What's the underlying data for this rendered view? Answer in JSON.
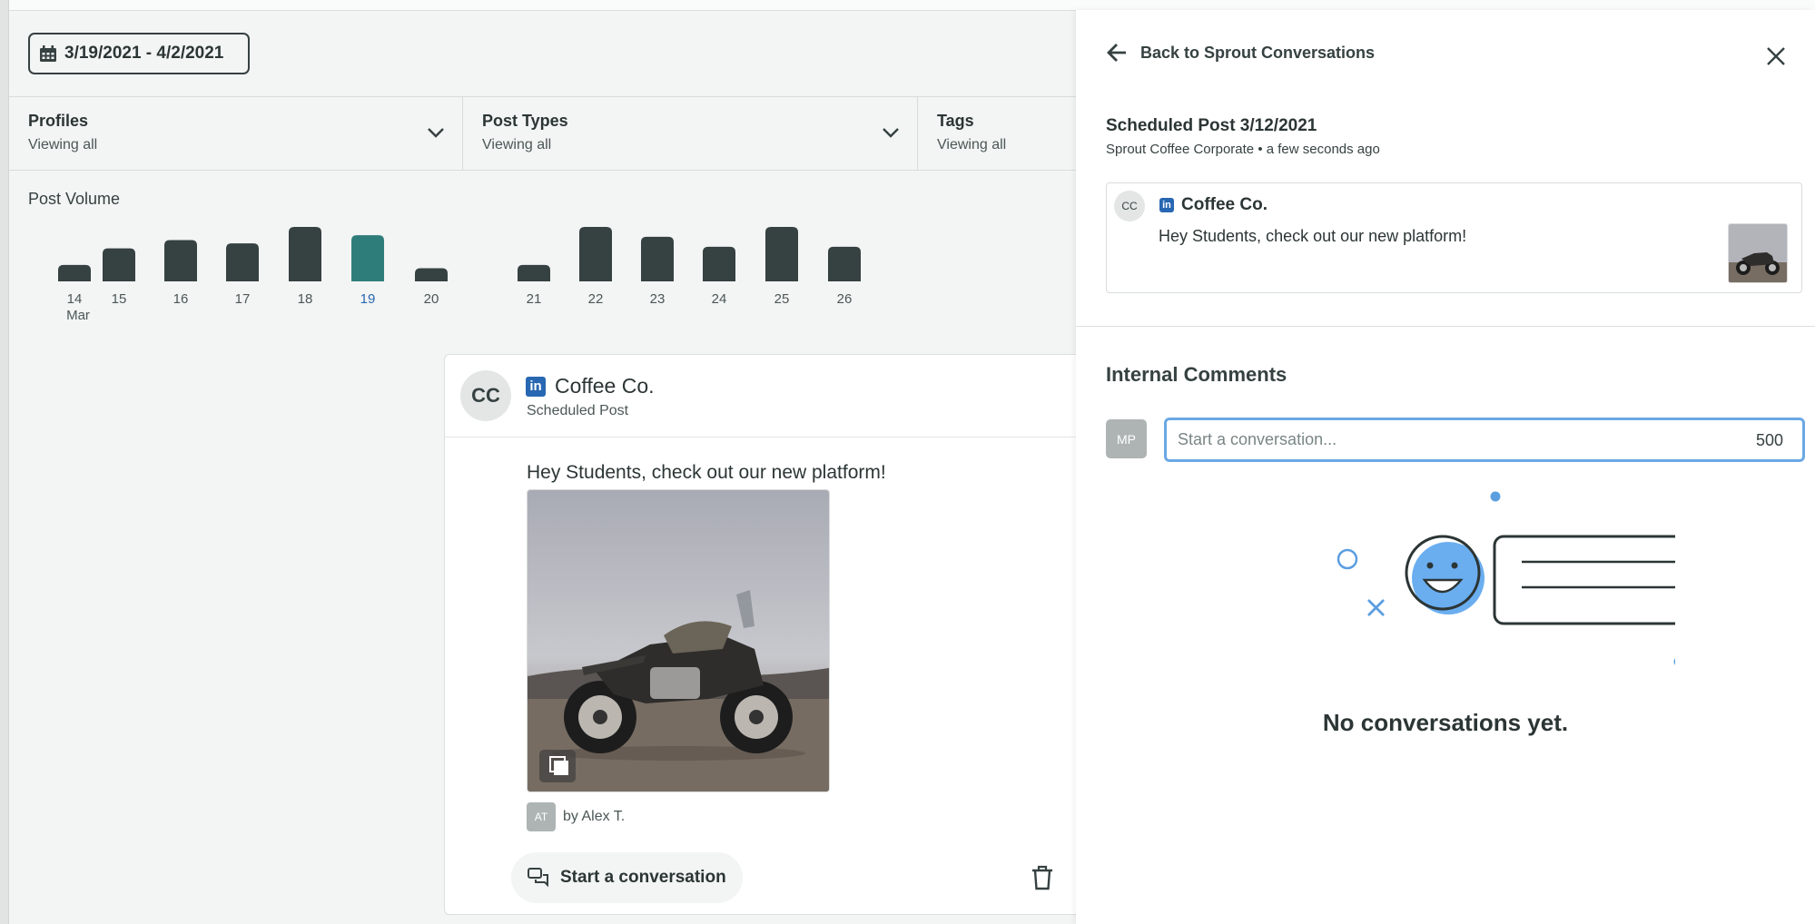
{
  "date_range": {
    "label": "3/19/2021 - 4/2/2021"
  },
  "filters": [
    {
      "title": "Profiles",
      "sub": "Viewing all"
    },
    {
      "title": "Post Types",
      "sub": "Viewing all"
    },
    {
      "title": "Tags",
      "sub": "Viewing all"
    }
  ],
  "post_volume": {
    "label": "Post Volume"
  },
  "chart_data": {
    "type": "bar",
    "title": "Post Volume",
    "categories": [
      "14",
      "15",
      "16",
      "17",
      "18",
      "19",
      "20",
      "21",
      "22",
      "23",
      "24",
      "25",
      "26"
    ],
    "values": [
      1,
      2,
      2.5,
      2.3,
      3.3,
      2.8,
      0.8,
      1,
      3.3,
      2.7,
      2.1,
      3.3,
      2.1
    ],
    "highlight_category": "19",
    "first_tick_sublabel": "Mar",
    "colors": {
      "bar": "#364141",
      "highlight": "#2e7d7b"
    }
  },
  "post_card": {
    "avatar": "CC",
    "network_icon": "in",
    "name": "Coffee Co.",
    "sub": "Scheduled Post",
    "text": "Hey Students, check out our new platform!",
    "author_avatar": "AT",
    "author": "by Alex T.",
    "start_conversation": "Start a conversation"
  },
  "panel": {
    "back": "Back to Sprout Conversations",
    "scheduled_title": "Scheduled Post 3/12/2021",
    "meta": "Sprout Coffee Corporate • a few seconds ago",
    "mini": {
      "avatar": "CC",
      "network_icon": "in",
      "name": "Coffee Co.",
      "text": "Hey Students, check out our new platform!"
    },
    "internal_comments": "Internal Comments",
    "user_avatar": "MP",
    "input_placeholder": "Start a conversation...",
    "char_count": "500",
    "empty_state": "No conversations yet."
  },
  "colors": {
    "accent_blue": "#6ba8e5",
    "linkedin": "#2867b2"
  }
}
